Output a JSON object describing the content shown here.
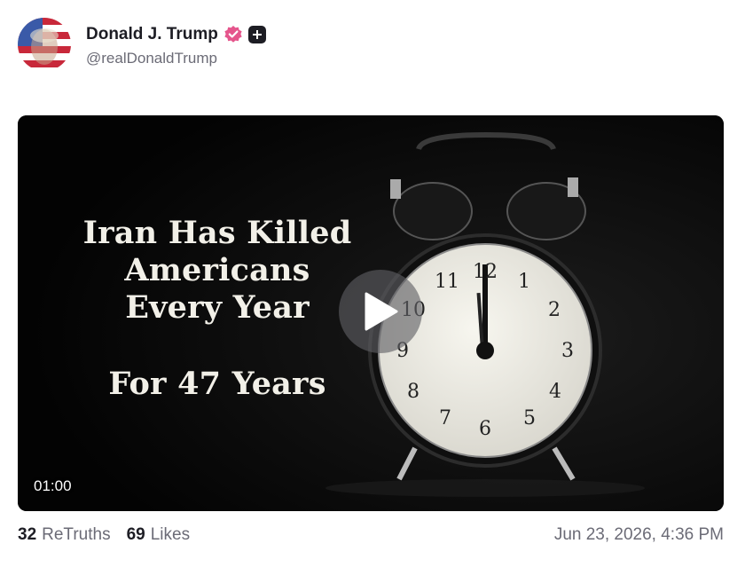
{
  "author": {
    "display_name": "Donald J. Trump",
    "handle": "@realDonaldTrump",
    "avatar_icon": "flag-portrait-avatar",
    "verified_icon": "verified-badge-icon",
    "verified_color": "#e5558c",
    "plus_icon": "plus-badge-icon"
  },
  "video": {
    "overlay_lines": [
      "Iran Has Killed",
      "Americans",
      "Every Year"
    ],
    "overlay_tagline": "For 47 Years",
    "duration": "01:00",
    "play_icon": "play-icon",
    "clock_numerals": [
      "12",
      "1",
      "2",
      "3",
      "4",
      "5",
      "6",
      "7",
      "8",
      "9",
      "10",
      "11"
    ]
  },
  "stats": {
    "retruths_count": "32",
    "retruths_label": "ReTruths",
    "likes_count": "69",
    "likes_label": "Likes"
  },
  "timestamp": "Jun 23, 2026, 4:36 PM"
}
